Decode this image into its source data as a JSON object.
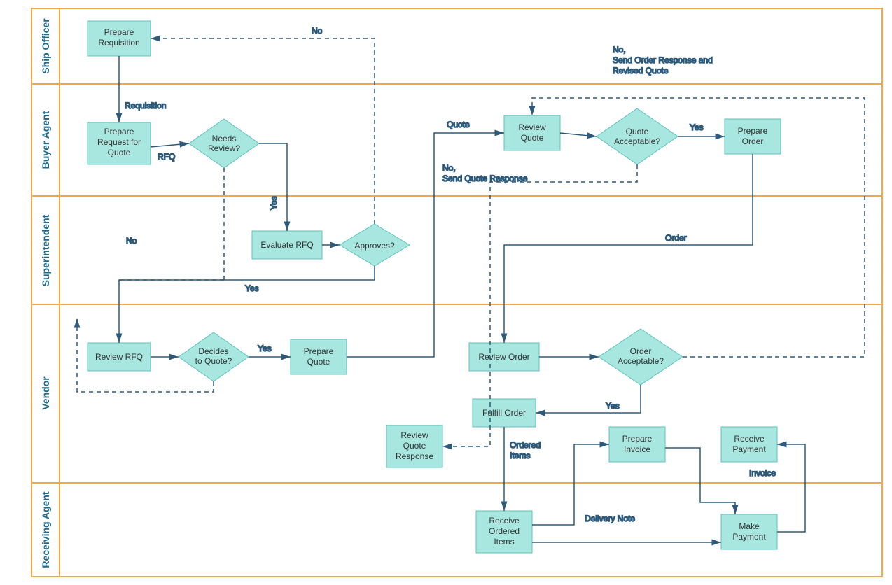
{
  "lanes": [
    {
      "id": "lane1",
      "label": "Ship Officer"
    },
    {
      "id": "lane2",
      "label": "Buyer Agent"
    },
    {
      "id": "lane3",
      "label": "Superintendent"
    },
    {
      "id": "lane4",
      "label": "Vendor"
    },
    {
      "id": "lane5",
      "label": "Receiving Agent"
    }
  ],
  "boxes": {
    "prepareRequisition": "Prepare\nRequisition",
    "prepareRFQ": "Prepare\nRequest for\nQuote",
    "needsReview": "Needs\nReview?",
    "evaluateRFQ": "Evaluate RFQ",
    "approves": "Approves?",
    "reviewRFQ": "Review RFQ",
    "decidesQuote": "Decides\nto Quote?",
    "prepareQuote": "Prepare\nQuote",
    "reviewQuote": "Review\nQuote",
    "quoteAcceptable": "Quote\nAcceptable?",
    "prepareOrder": "Prepare\nOrder",
    "reviewOrder": "Review Order",
    "orderAcceptable": "Order\nAcceptable?",
    "fulfillOrder": "Fulfill Order",
    "prepareInvoice": "Prepare\nInvoice",
    "receivePayment": "Receive\nPayment",
    "reviewQuoteResponse": "Review\nQuote\nResponse",
    "receiveOrderedItems": "Receive\nOrdered\nItems",
    "makePayment": "Make\nPayment"
  },
  "labels": {
    "requisition": "Requisition",
    "rfq": "RFQ",
    "yes": "Yes",
    "no": "No",
    "quote": "Quote",
    "noSendQuoteResponse": "No,\nSend Quote Response",
    "noSendOrderResponse": "No,\nSend Order Response and\nRevised Quote",
    "order": "Order",
    "orderedItems": "Ordered\nItems",
    "deliveryNote": "Delivery Note",
    "invoice": "Invoice"
  },
  "colors": {
    "laneBorder": "#f5a847",
    "boxFill": "#a8e6e0",
    "boxStroke": "#5bc4bc",
    "line": "#2d5a7a",
    "laneLabel": "#1a6b8f"
  }
}
